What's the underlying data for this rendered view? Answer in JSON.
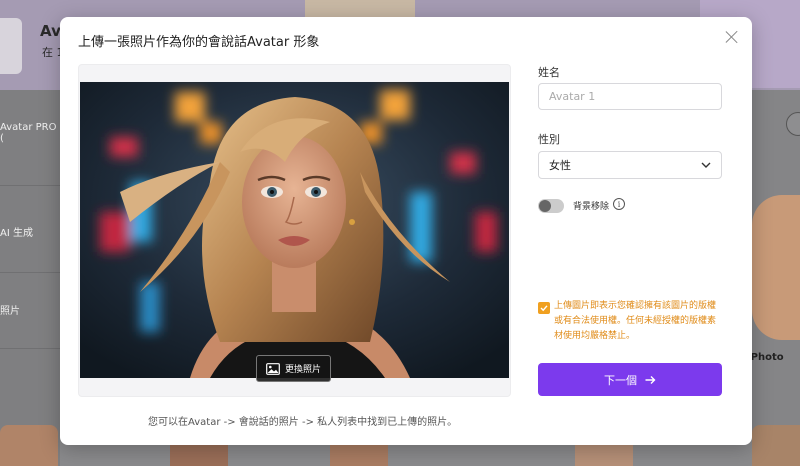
{
  "background": {
    "title": "Av",
    "subtitle": "在 1",
    "side_items": [
      "Avatar PRO (",
      "AI 生成",
      "照片"
    ],
    "photo_label": "g Photo"
  },
  "modal": {
    "title": "上傳一張照片作為你的會說話Avatar 形象",
    "replace_button": "更換照片",
    "hint": "您可以在Avatar -> 會說話的照片 -> 私人列表中找到已上傳的照片。",
    "name_label": "姓名",
    "name_placeholder": "Avatar 1",
    "name_value": "",
    "gender_label": "性別",
    "gender_value": "女性",
    "bg_removal_label": "背景移除",
    "bg_removal_enabled": false,
    "info_icon_glyph": "i",
    "notice_checked": true,
    "notice_text": "上傳圖片即表示您確認擁有該圖片的版權或有合法使用權。任何未經授權的版權素材使用均嚴格禁止。",
    "next_button": "下一個",
    "accent_color": "#7c3aed",
    "notice_color": "#e08c1a"
  }
}
